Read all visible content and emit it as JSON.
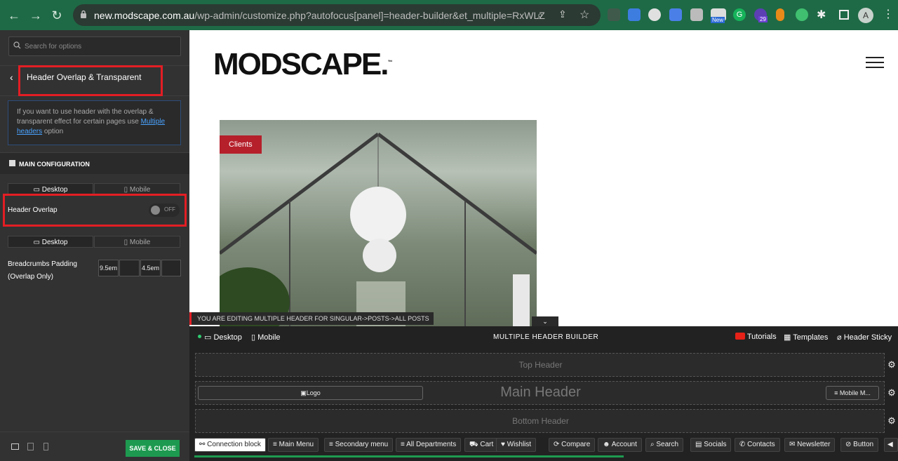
{
  "browser": {
    "url_domain": "new.modscape.com.au",
    "url_path": "/wp-admin/customize.php?autofocus[panel]=header-builder&et_multiple=RxWLZ",
    "profile_initial": "A",
    "ext_badge_new": "New",
    "ext_badge_count": "29"
  },
  "sidebar": {
    "search_placeholder": "Search for options",
    "panel_title": "Header Overlap & Transparent",
    "info_text": "If you want to use header with the overlap & transparent effect for certain pages use",
    "info_link": "Multiple headers",
    "info_suffix": "option",
    "section_title": "MAIN CONFIGURATION",
    "device_tabs": [
      "Desktop",
      "Mobile"
    ],
    "header_overlap_label": "Header Overlap",
    "toggle_state": "OFF",
    "breadcrumbs_label_1": "Breadcrumbs Padding",
    "breadcrumbs_label_2": "(Overlap Only)",
    "pad_values": [
      "9.5em",
      "",
      "4.5em",
      ""
    ],
    "save_button": "SAVE & CLOSE"
  },
  "preview": {
    "logo": "MODSCAPE.",
    "logo_tm": "™",
    "badge": "Clients"
  },
  "builder": {
    "editing_notice": "YOU ARE EDITING MULTIPLE HEADER FOR SINGULAR->POSTS->ALL POSTS",
    "device_desktop": "Desktop",
    "device_mobile": "Mobile",
    "title": "MULTIPLE HEADER BUILDER",
    "tutorials": "Tutorials",
    "templates": "Templates",
    "header_sticky": "Header Sticky",
    "top_header": "Top Header",
    "main_header": "Main Header",
    "bottom_header": "Bottom Header",
    "logo_block": "Logo",
    "mobile_menu_block": "Mobile M...",
    "chips": [
      "Connection block",
      "Main Menu",
      "Secondary menu",
      "All Departments",
      "Cart",
      "Wishlist",
      "Compare",
      "Account",
      "Search",
      "Socials",
      "Contacts",
      "Newsletter",
      "Button"
    ]
  },
  "colors": {
    "highlight": "#e31e24",
    "save": "#1e9a50",
    "badge": "#b5202b",
    "chrome": "#1e6a46"
  }
}
